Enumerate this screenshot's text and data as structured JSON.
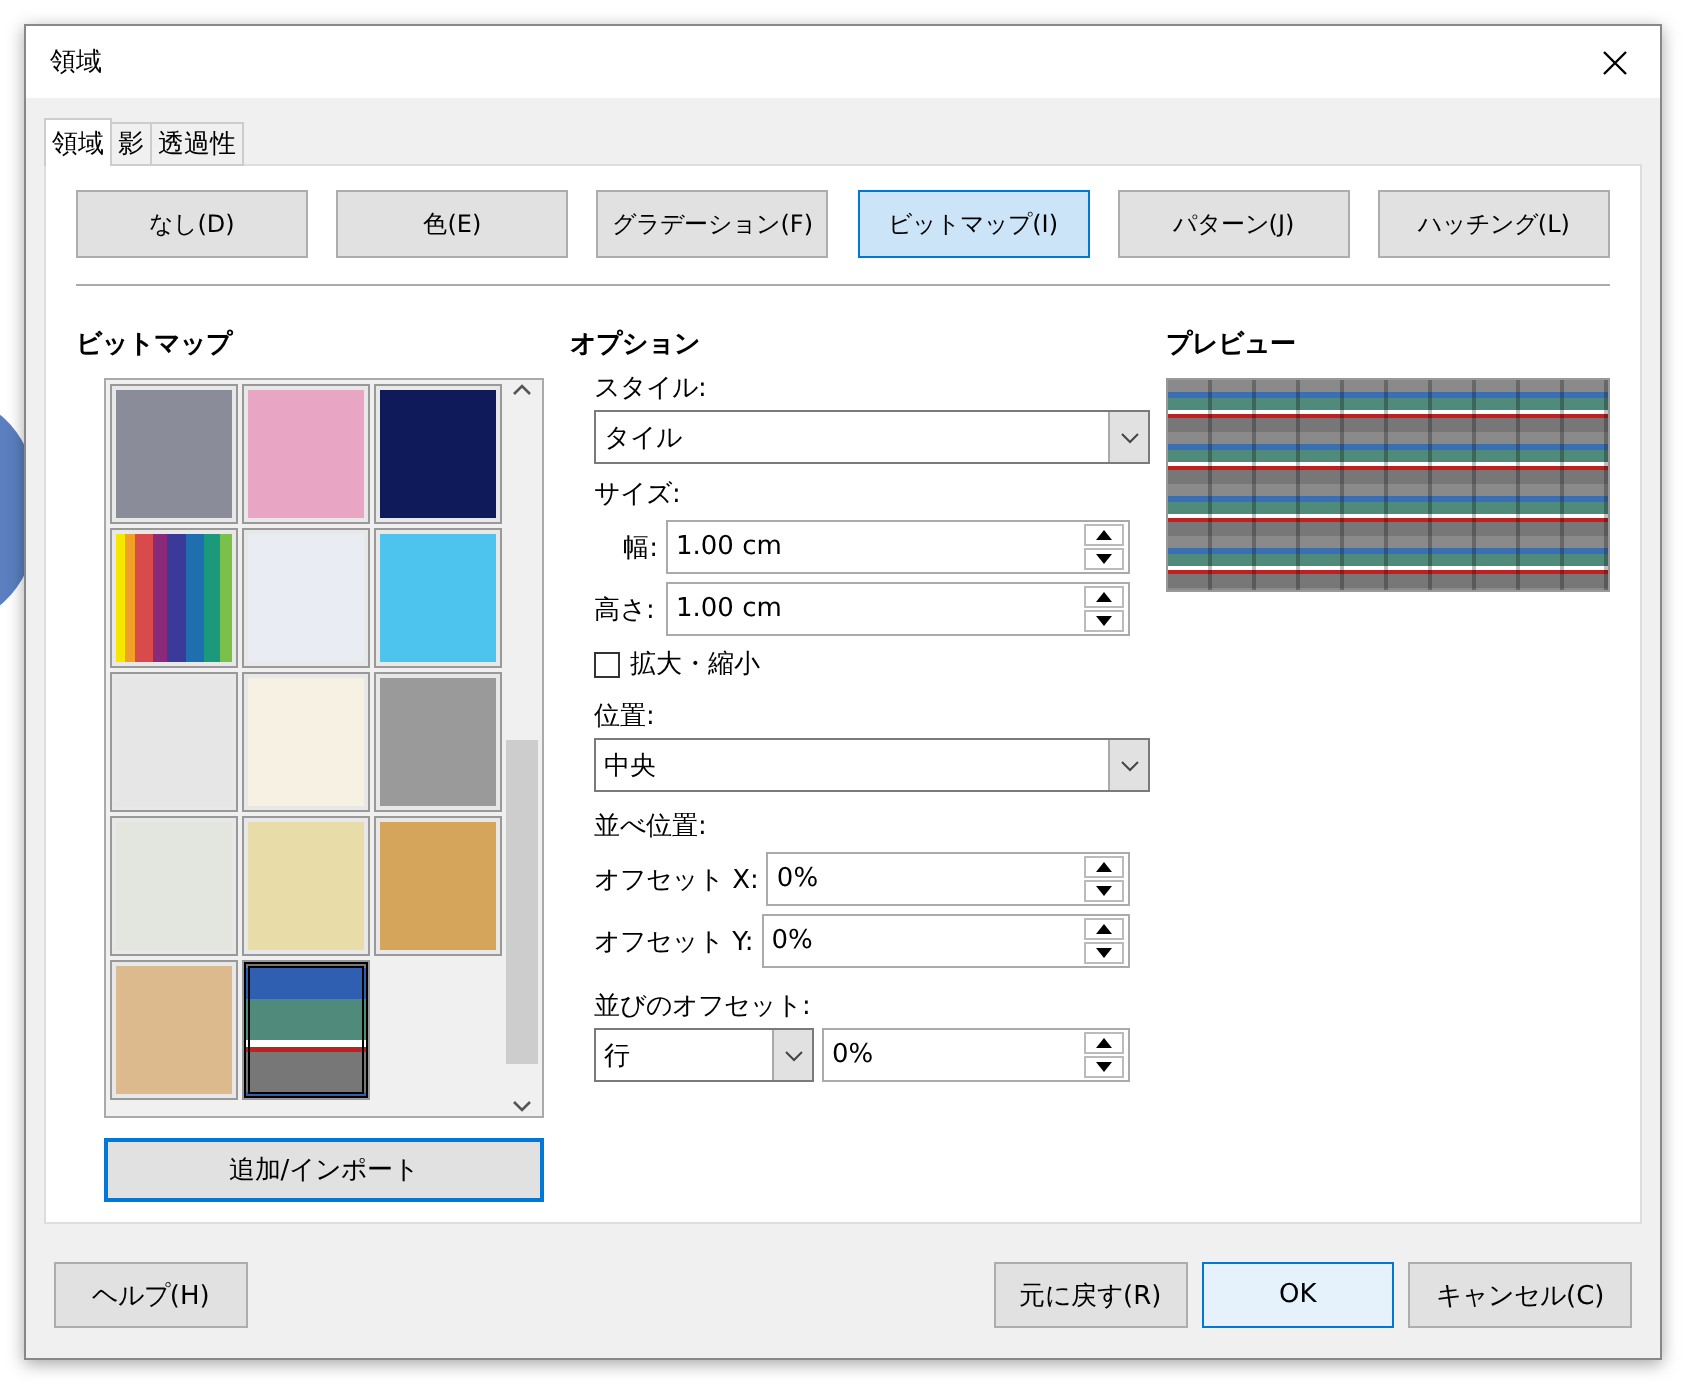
{
  "window": {
    "title": "領域"
  },
  "tabs": [
    {
      "label": "領域",
      "selected": true
    },
    {
      "label": "影",
      "selected": false
    },
    {
      "label": "透過性",
      "selected": false
    }
  ],
  "fill_types": [
    {
      "label": "なし(D)",
      "selected": false
    },
    {
      "label": "色(E)",
      "selected": false
    },
    {
      "label": "グラデーション(F)",
      "selected": false
    },
    {
      "label": "ビットマップ(I)",
      "selected": true
    },
    {
      "label": "パターン(J)",
      "selected": false
    },
    {
      "label": "ハッチング(L)",
      "selected": false
    }
  ],
  "bitmap": {
    "heading": "ビットマップ",
    "add_button": "追加/インポート",
    "tiles": [
      {
        "kind": "swatch",
        "color": "#8a8d99",
        "selected": false
      },
      {
        "kind": "swatch",
        "color": "#e8a6c4",
        "selected": false
      },
      {
        "kind": "swatch",
        "color": "#0f1a5a",
        "selected": false
      },
      {
        "kind": "stripes",
        "color": "#d94b4b",
        "selected": false
      },
      {
        "kind": "swatch",
        "color": "#e9ecf2",
        "selected": false
      },
      {
        "kind": "swatch",
        "color": "#4cc4ee",
        "selected": false
      },
      {
        "kind": "swatch",
        "color": "#e6e6e6",
        "selected": false
      },
      {
        "kind": "swatch",
        "color": "#f6f1e3",
        "selected": false
      },
      {
        "kind": "swatch",
        "color": "#9a9a9a",
        "selected": false
      },
      {
        "kind": "swatch",
        "color": "#e3e5df",
        "selected": false
      },
      {
        "kind": "swatch",
        "color": "#e8dca8",
        "selected": false
      },
      {
        "kind": "swatch",
        "color": "#d4a55a",
        "selected": false
      },
      {
        "kind": "swatch",
        "color": "#ddb98e",
        "selected": false
      },
      {
        "kind": "photo",
        "color": "#4f8a7a",
        "selected": true
      }
    ]
  },
  "options": {
    "heading": "オプション",
    "style": {
      "label": "スタイル:",
      "value": "タイル"
    },
    "size": {
      "label": "サイズ:",
      "width": {
        "label": "幅:",
        "value": "1.00 cm"
      },
      "height": {
        "label": "高さ:",
        "value": "1.00 cm"
      }
    },
    "scale": {
      "label": "拡大・縮小",
      "checked": false
    },
    "position": {
      "label": "位置:",
      "value": "中央"
    },
    "tiling": {
      "label": "並べ位置:",
      "offset_x": {
        "label": "オフセット X:",
        "value": "0%"
      },
      "offset_y": {
        "label": "オフセット Y:",
        "value": "0%"
      }
    },
    "row_offset": {
      "label": "並びのオフセット:",
      "mode": "行",
      "value": "0%"
    }
  },
  "preview": {
    "heading": "プレビュー"
  },
  "footer": [
    {
      "label": "ヘルプ(H)",
      "primary": false
    },
    {
      "label": "元に戻す(R)",
      "primary": false
    },
    {
      "label": "OK",
      "primary": true
    },
    {
      "label": "キャンセル(C)",
      "primary": false
    }
  ]
}
